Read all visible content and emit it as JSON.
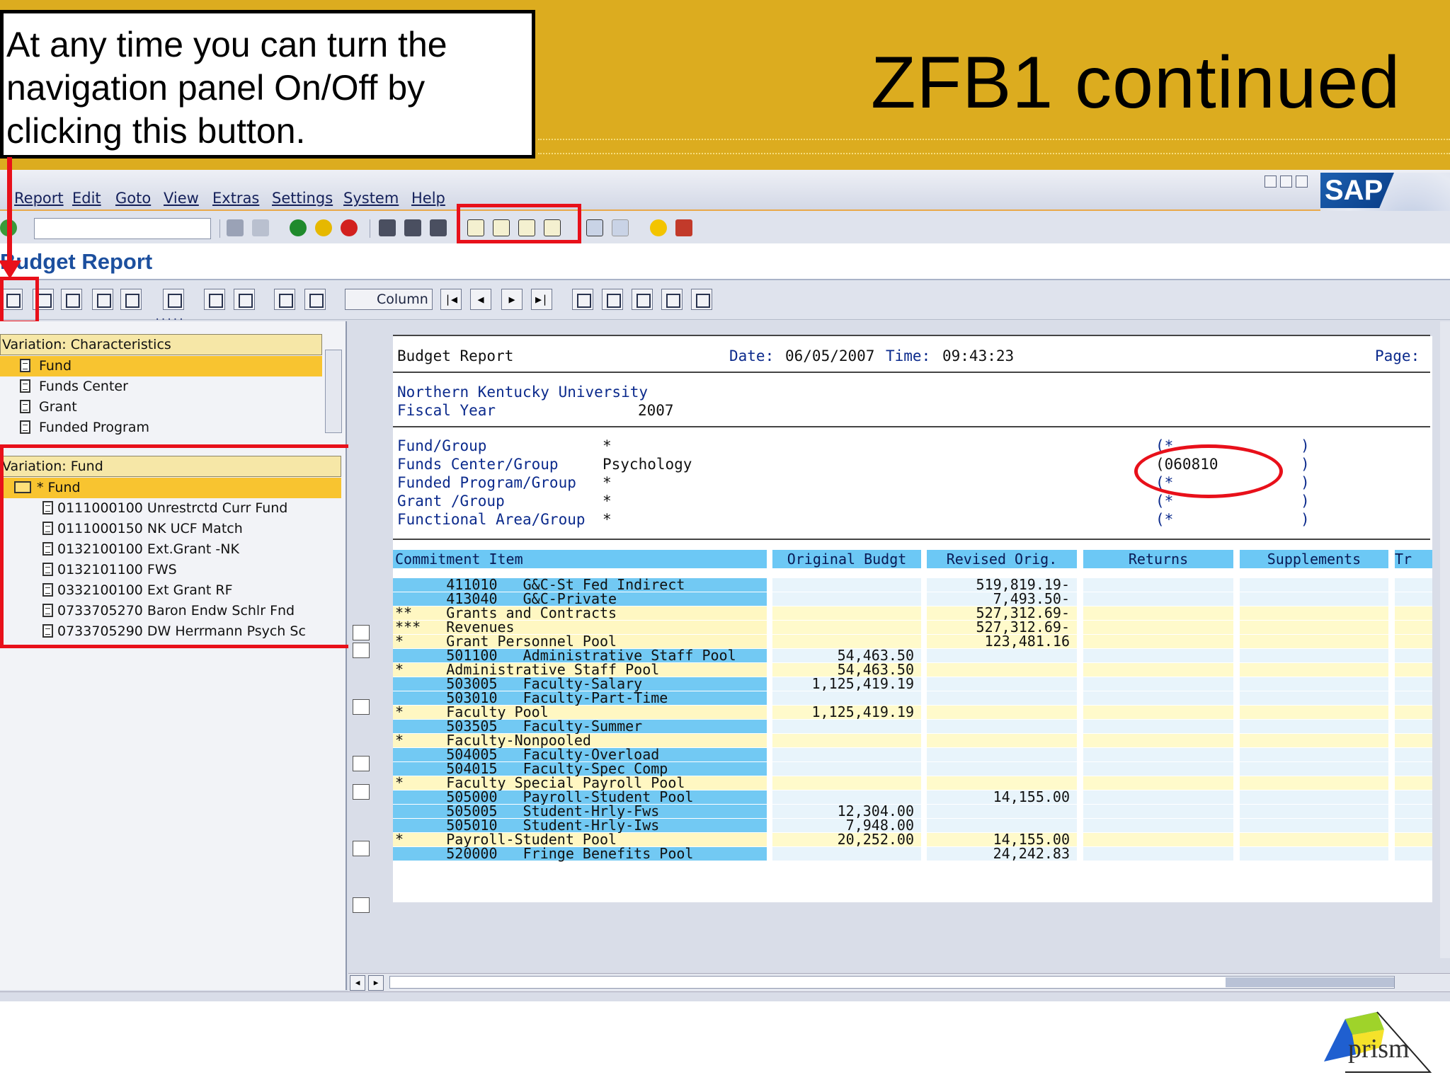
{
  "slide": {
    "title": "ZFB1 continued",
    "callout_lines": [
      "At any time you can turn the",
      "navigation panel On/Off by",
      "clicking this button."
    ],
    "logo_text": "prism"
  },
  "sap": {
    "logo_text": "SAP",
    "menu": [
      "Report",
      "Edit",
      "Goto",
      "View",
      "Extras",
      "Settings",
      "System",
      "Help"
    ],
    "command_field_value": "",
    "screen_title": "Budget Report",
    "column_button": "Column",
    "splitter": "....."
  },
  "nav": {
    "characteristics_header": "Variation: Characteristics",
    "characteristics": [
      "Fund",
      "Funds Center",
      "Grant",
      "Funded Program"
    ],
    "fund_header": "Variation: Fund",
    "fund_root": "* Fund",
    "funds": [
      "0111000100 Unrestrctd Curr Fund",
      "0111000150 NK UCF Match",
      "0132100100 Ext.Grant -NK",
      "0132101100 FWS",
      "0332100100 Ext Grant RF",
      "0733705270 Baron Endw Schlr Fnd",
      "0733705290 DW Herrmann Psych Sc"
    ]
  },
  "report": {
    "name": "Budget Report",
    "date_label": "Date:",
    "date": "06/05/2007",
    "time_label": "Time:",
    "time": "09:43:23",
    "page_label": "Page:",
    "org": "Northern Kentucky University",
    "fy_label": "Fiscal Year",
    "fy": "2007",
    "selections": [
      {
        "label": "Fund/Group",
        "value": "*",
        "paren": "(*",
        "close": ")"
      },
      {
        "label": "Funds Center/Group",
        "value": "Psychology",
        "paren": "(060810",
        "close": ")"
      },
      {
        "label": "Funded Program/Group",
        "value": "*",
        "paren": "(*",
        "close": ")"
      },
      {
        "label": "Grant /Group",
        "value": "*",
        "paren": "(*",
        "close": ")"
      },
      {
        "label": "Functional Area/Group",
        "value": "*",
        "paren": "(*",
        "close": ")"
      }
    ],
    "columns": [
      "Commitment Item",
      "Original Budgt",
      "Revised Orig.",
      "Returns",
      "Supplements",
      "Tr"
    ],
    "rows": [
      {
        "style": "blue",
        "item": "      411010   G&C-St Fed Indirect",
        "orig": "",
        "rev": "519,819.19-"
      },
      {
        "style": "blue",
        "item": "      413040   G&C-Private",
        "orig": "",
        "rev": "7,493.50-"
      },
      {
        "style": "yellow",
        "item": "**    Grants and Contracts",
        "orig": "",
        "rev": "527,312.69-"
      },
      {
        "style": "yellow",
        "item": "***   Revenues",
        "orig": "",
        "rev": "527,312.69-"
      },
      {
        "style": "yellow",
        "item": "*     Grant Personnel Pool",
        "orig": "",
        "rev": "123,481.16"
      },
      {
        "style": "blue",
        "item": "      501100   Administrative Staff Pool",
        "orig": "54,463.50",
        "rev": ""
      },
      {
        "style": "yellow",
        "item": "*     Administrative Staff Pool",
        "orig": "54,463.50",
        "rev": ""
      },
      {
        "style": "blue",
        "item": "      503005   Faculty-Salary",
        "orig": "1,125,419.19",
        "rev": ""
      },
      {
        "style": "blue",
        "item": "      503010   Faculty-Part-Time",
        "orig": "",
        "rev": ""
      },
      {
        "style": "yellow",
        "item": "*     Faculty Pool",
        "orig": "1,125,419.19",
        "rev": ""
      },
      {
        "style": "blue",
        "item": "      503505   Faculty-Summer",
        "orig": "",
        "rev": ""
      },
      {
        "style": "yellow",
        "item": "*     Faculty-Nonpooled",
        "orig": "",
        "rev": ""
      },
      {
        "style": "blue",
        "item": "      504005   Faculty-Overload",
        "orig": "",
        "rev": ""
      },
      {
        "style": "blue",
        "item": "      504015   Faculty-Spec Comp",
        "orig": "",
        "rev": ""
      },
      {
        "style": "yellow",
        "item": "*     Faculty Special Payroll Pool",
        "orig": "",
        "rev": ""
      },
      {
        "style": "blue",
        "item": "      505000   Payroll-Student Pool",
        "orig": "",
        "rev": "14,155.00"
      },
      {
        "style": "blue",
        "item": "      505005   Student-Hrly-Fws",
        "orig": "12,304.00",
        "rev": ""
      },
      {
        "style": "blue",
        "item": "      505010   Student-Hrly-Iws",
        "orig": "7,948.00",
        "rev": ""
      },
      {
        "style": "yellow",
        "item": "*     Payroll-Student Pool",
        "orig": "20,252.00",
        "rev": "14,155.00"
      },
      {
        "style": "blue",
        "item": "      520000   Fringe Benefits Pool",
        "orig": "",
        "rev": "24,242.83"
      }
    ]
  },
  "colors": {
    "slide_header": "#dcac1f",
    "highlight_red": "#e8101a",
    "sap_blue_row": "#72c9f3",
    "sap_yellow_row": "#fff7c2",
    "selected_nav": "#f8c430"
  }
}
